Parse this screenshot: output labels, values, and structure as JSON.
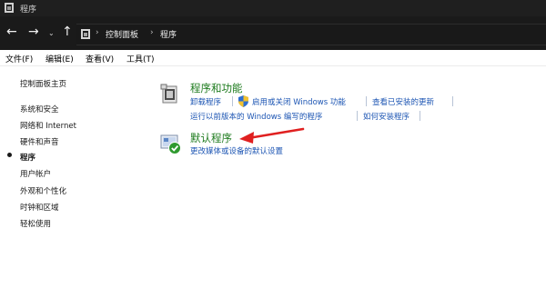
{
  "window": {
    "title": "程序"
  },
  "nav": {
    "back": "←",
    "forward": "→",
    "recent": "⌄",
    "up": "↑"
  },
  "address": {
    "separator": "›",
    "crumbs": [
      "控制面板",
      "程序"
    ]
  },
  "menu": [
    "文件(F)",
    "编辑(E)",
    "查看(V)",
    "工具(T)"
  ],
  "sidebar": {
    "home": "控制面板主页",
    "items": [
      "系统和安全",
      "网络和 Internet",
      "硬件和声音",
      "程序",
      "用户帐户",
      "外观和个性化",
      "时钟和区域",
      "轻松使用"
    ],
    "current_index": 3
  },
  "sections": [
    {
      "title": "程序和功能",
      "links": [
        "卸载程序",
        "启用或关闭 Windows 功能",
        "查看已安装的更新",
        "运行以前版本的 Windows 编写的程序",
        "如何安装程序"
      ]
    },
    {
      "title": "默认程序",
      "links": [
        "更改媒体或设备的默认设置"
      ]
    }
  ],
  "colors": {
    "link": "#1c55b3",
    "section_title": "#1e7b1e",
    "annotation_arrow": "#e02020",
    "titlebar": "#1f1f1f"
  }
}
